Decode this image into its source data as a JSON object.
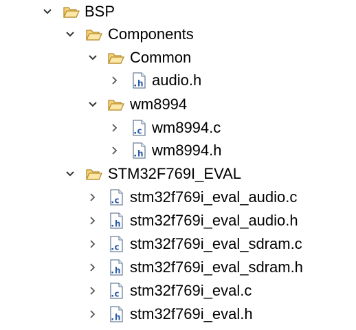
{
  "tree": [
    {
      "label": "BSP",
      "kind": "folder",
      "expanded": true,
      "depth": 0
    },
    {
      "label": "Components",
      "kind": "folder",
      "expanded": true,
      "depth": 1
    },
    {
      "label": "Common",
      "kind": "folder",
      "expanded": true,
      "depth": 2
    },
    {
      "label": "audio.h",
      "kind": "h-file",
      "expanded": false,
      "depth": 3
    },
    {
      "label": "wm8994",
      "kind": "folder",
      "expanded": true,
      "depth": 2
    },
    {
      "label": "wm8994.c",
      "kind": "c-file",
      "expanded": false,
      "depth": 3
    },
    {
      "label": "wm8994.h",
      "kind": "h-file",
      "expanded": false,
      "depth": 3
    },
    {
      "label": "STM32F769I_EVAL",
      "kind": "folder",
      "expanded": true,
      "depth": 1
    },
    {
      "label": "stm32f769i_eval_audio.c",
      "kind": "c-file",
      "expanded": false,
      "depth": 2
    },
    {
      "label": "stm32f769i_eval_audio.h",
      "kind": "h-file",
      "expanded": false,
      "depth": 2
    },
    {
      "label": "stm32f769i_eval_sdram.c",
      "kind": "c-file",
      "expanded": false,
      "depth": 2
    },
    {
      "label": "stm32f769i_eval_sdram.h",
      "kind": "h-file",
      "expanded": false,
      "depth": 2
    },
    {
      "label": "stm32f769i_eval.c",
      "kind": "c-file",
      "expanded": false,
      "depth": 2
    },
    {
      "label": "stm32f769i_eval.h",
      "kind": "h-file",
      "expanded": false,
      "depth": 2
    }
  ],
  "icons": {
    "folder": "folder-open-icon",
    "c-file": "c-file-icon",
    "h-file": "h-file-icon",
    "expanded": "chevron-down-icon",
    "collapsed": "chevron-right-icon"
  },
  "colors": {
    "folder_fill": "#f5d27a",
    "folder_stroke": "#b88a2a",
    "file_letter": "#2a5aa8",
    "file_border": "#6b7f99",
    "chevron": "#333333"
  }
}
